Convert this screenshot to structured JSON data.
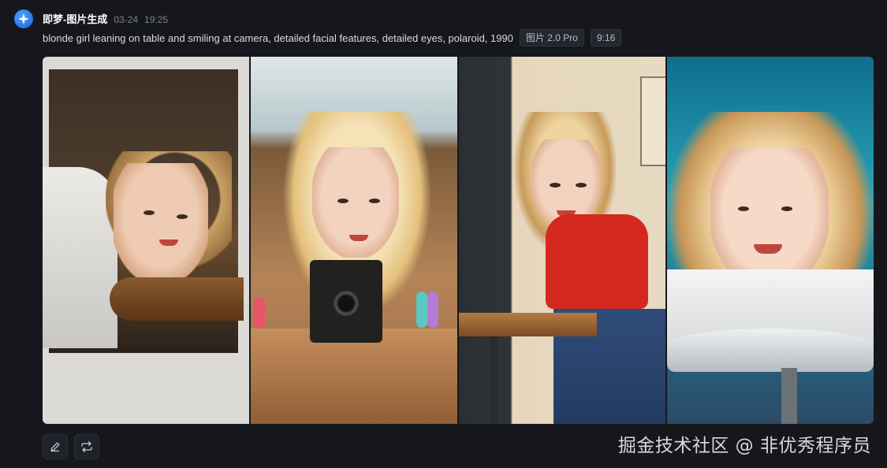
{
  "header": {
    "app_name": "即梦-图片生成",
    "date": "03-24",
    "time": "19:25",
    "avatar_icon": "star-logo-icon"
  },
  "prompt": {
    "text": "blonde girl leaning on table and smiling at camera, detailed facial features, detailed eyes, polaroid, 1990",
    "model_tag": "图片 2.0 Pro",
    "ratio_tag": "9:16"
  },
  "images": [
    {
      "name": "generated-image-1",
      "style": "polaroid warm interior, white shirt"
    },
    {
      "name": "generated-image-2",
      "style": "sunny, holding instant camera, red top"
    },
    {
      "name": "generated-image-3",
      "style": "red crop top, jeans, cafe wall"
    },
    {
      "name": "generated-image-4",
      "style": "teal background, white shirt, round table"
    }
  ],
  "actions": {
    "edit_icon": "pencil-icon",
    "regenerate_icon": "regenerate-icon"
  },
  "watermark": "掘金技术社区 @ 非优秀程序员",
  "colors": {
    "background": "#15171c",
    "accent": "#2f7df6",
    "tag_bg": "#24272e"
  }
}
